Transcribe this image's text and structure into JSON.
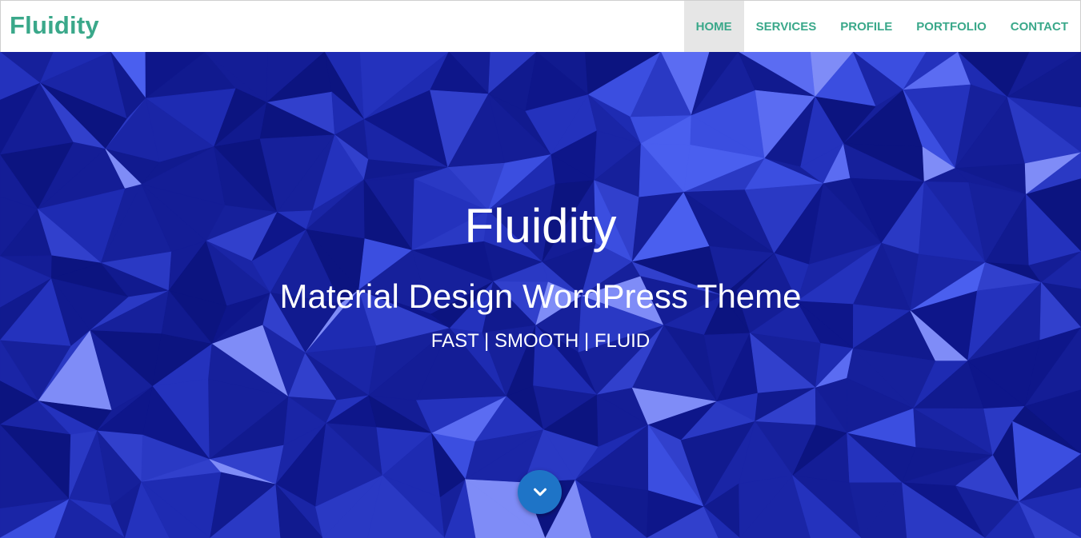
{
  "brand": {
    "name": "Fluidity",
    "color": "#3aa88a"
  },
  "nav": {
    "items": [
      {
        "label": "HOME",
        "active": true
      },
      {
        "label": "SERVICES",
        "active": false
      },
      {
        "label": "PROFILE",
        "active": false
      },
      {
        "label": "PORTFOLIO",
        "active": false
      },
      {
        "label": "CONTACT",
        "active": false
      }
    ]
  },
  "hero": {
    "title": "Fluidity",
    "subtitle": "Material Design WordPress Theme",
    "tagline": "FAST | SMOOTH | FLUID",
    "background_color": "#1a23a3",
    "scroll_icon": "chevron-down-icon",
    "scroll_button_color": "#1e74c7"
  }
}
